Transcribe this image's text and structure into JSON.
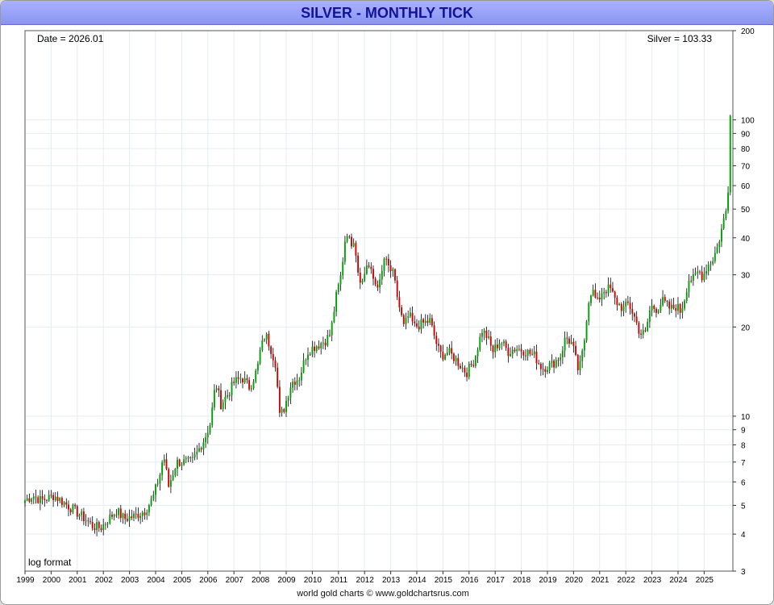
{
  "chart_data": {
    "type": "line",
    "title": "SILVER - MONTHLY TICK",
    "scale": "log",
    "ylim": [
      3,
      200
    ],
    "xlim": [
      1999.0,
      2026.1
    ],
    "y_ticks": [
      3,
      4,
      5,
      6,
      7,
      8,
      9,
      10,
      20,
      30,
      40,
      50,
      60,
      70,
      80,
      90,
      100,
      200
    ],
    "x_ticks": [
      "1999",
      "2000",
      "2001",
      "2002",
      "2003",
      "2004",
      "2005",
      "2006",
      "2007",
      "2008",
      "2009",
      "2010",
      "2011",
      "2012",
      "2013",
      "2014",
      "2015",
      "2016",
      "2017",
      "2018",
      "2019",
      "2020",
      "2021",
      "2022",
      "2023",
      "2024",
      "2025"
    ],
    "grid": true,
    "date_readout": "Date = 2026.01",
    "price_readout": "Silver = 103.33",
    "scale_note": "log format",
    "footer": "world gold charts © www.goldchartsrus.com",
    "up_color": "#00a000",
    "down_color": "#d00000",
    "bar_color": "#000000",
    "anchors": [
      [
        1999.0,
        5.2
      ],
      [
        1999.3,
        5.4
      ],
      [
        1999.6,
        5.2
      ],
      [
        1999.9,
        5.3
      ],
      [
        2000.1,
        5.4
      ],
      [
        2000.5,
        5.1
      ],
      [
        2000.9,
        4.8
      ],
      [
        2001.3,
        4.5
      ],
      [
        2001.6,
        4.25
      ],
      [
        2001.9,
        4.2
      ],
      [
        2002.2,
        4.5
      ],
      [
        2002.5,
        4.8
      ],
      [
        2002.8,
        4.5
      ],
      [
        2003.2,
        4.6
      ],
      [
        2003.6,
        4.8
      ],
      [
        2003.9,
        5.3
      ],
      [
        2004.2,
        6.5
      ],
      [
        2004.3,
        7.5
      ],
      [
        2004.5,
        5.8
      ],
      [
        2004.8,
        7.0
      ],
      [
        2005.0,
        7.0
      ],
      [
        2005.4,
        7.0
      ],
      [
        2005.9,
        8.5
      ],
      [
        2006.1,
        9.5
      ],
      [
        2006.3,
        13.0
      ],
      [
        2006.5,
        11.0
      ],
      [
        2006.8,
        12.0
      ],
      [
        2007.0,
        13.0
      ],
      [
        2007.3,
        13.5
      ],
      [
        2007.6,
        12.5
      ],
      [
        2007.9,
        14.5
      ],
      [
        2008.0,
        16.5
      ],
      [
        2008.2,
        19.0
      ],
      [
        2008.4,
        17.0
      ],
      [
        2008.6,
        15.0
      ],
      [
        2008.75,
        10.0
      ],
      [
        2008.9,
        10.5
      ],
      [
        2009.2,
        13.0
      ],
      [
        2009.5,
        13.5
      ],
      [
        2009.8,
        16.5
      ],
      [
        2010.0,
        17.0
      ],
      [
        2010.5,
        18.0
      ],
      [
        2010.7,
        19.0
      ],
      [
        2010.9,
        25.0
      ],
      [
        2011.1,
        30.0
      ],
      [
        2011.3,
        43.0
      ],
      [
        2011.45,
        38.0
      ],
      [
        2011.6,
        40.0
      ],
      [
        2011.75,
        31.0
      ],
      [
        2011.9,
        28.0
      ],
      [
        2012.1,
        33.0
      ],
      [
        2012.4,
        28.0
      ],
      [
        2012.6,
        28.0
      ],
      [
        2012.75,
        34.0
      ],
      [
        2012.9,
        32.0
      ],
      [
        2013.1,
        30.0
      ],
      [
        2013.3,
        24.0
      ],
      [
        2013.5,
        20.0
      ],
      [
        2013.7,
        22.0
      ],
      [
        2013.9,
        20.0
      ],
      [
        2014.2,
        20.5
      ],
      [
        2014.5,
        21.0
      ],
      [
        2014.8,
        17.0
      ],
      [
        2014.95,
        16.0
      ],
      [
        2015.2,
        16.5
      ],
      [
        2015.5,
        15.5
      ],
      [
        2015.9,
        14.0
      ],
      [
        2016.2,
        15.5
      ],
      [
        2016.5,
        19.5
      ],
      [
        2016.7,
        18.5
      ],
      [
        2016.9,
        16.5
      ],
      [
        2017.2,
        18.0
      ],
      [
        2017.5,
        16.5
      ],
      [
        2017.8,
        17.0
      ],
      [
        2018.2,
        16.5
      ],
      [
        2018.5,
        16.0
      ],
      [
        2018.8,
        14.5
      ],
      [
        2019.2,
        15.0
      ],
      [
        2019.5,
        16.0
      ],
      [
        2019.7,
        18.5
      ],
      [
        2019.95,
        17.5
      ],
      [
        2020.2,
        14.0
      ],
      [
        2020.4,
        17.5
      ],
      [
        2020.55,
        24.0
      ],
      [
        2020.7,
        27.0
      ],
      [
        2020.9,
        24.0
      ],
      [
        2021.1,
        26.5
      ],
      [
        2021.4,
        27.0
      ],
      [
        2021.6,
        24.5
      ],
      [
        2021.9,
        23.0
      ],
      [
        2022.1,
        24.0
      ],
      [
        2022.3,
        22.0
      ],
      [
        2022.55,
        19.0
      ],
      [
        2022.75,
        19.0
      ],
      [
        2022.95,
        23.5
      ],
      [
        2023.2,
        23.0
      ],
      [
        2023.4,
        24.5
      ],
      [
        2023.7,
        23.0
      ],
      [
        2023.95,
        23.5
      ],
      [
        2024.1,
        22.5
      ],
      [
        2024.25,
        25.0
      ],
      [
        2024.4,
        29.0
      ],
      [
        2024.6,
        29.0
      ],
      [
        2024.8,
        31.0
      ],
      [
        2024.95,
        29.5
      ],
      [
        2025.1,
        32.0
      ],
      [
        2025.3,
        33.5
      ],
      [
        2025.5,
        37.0
      ],
      [
        2025.65,
        42.0
      ],
      [
        2025.8,
        48.0
      ],
      [
        2025.9,
        52.0
      ],
      [
        2025.95,
        75.0
      ],
      [
        2026.01,
        103.33
      ]
    ]
  }
}
